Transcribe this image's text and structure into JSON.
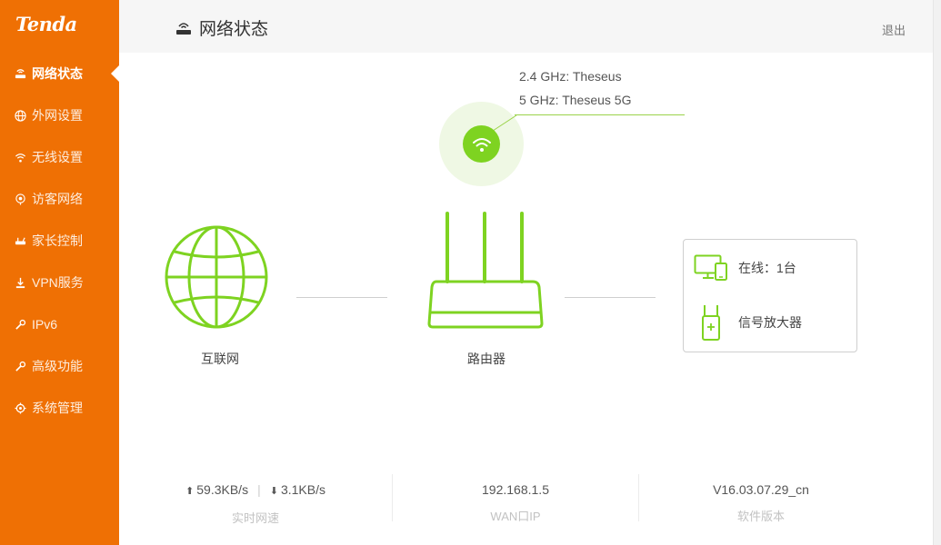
{
  "brand": {
    "logo_text": "Tenda",
    "accent": "#ef7004",
    "green": "#7ed321"
  },
  "sidebar": {
    "items": [
      {
        "label": "网络状态",
        "icon": "router-icon",
        "active": true
      },
      {
        "label": "外网设置",
        "icon": "globe-icon",
        "active": false
      },
      {
        "label": "无线设置",
        "icon": "wifi-icon",
        "active": false
      },
      {
        "label": "访客网络",
        "icon": "guest-icon",
        "active": false
      },
      {
        "label": "家长控制",
        "icon": "parental-icon",
        "active": false
      },
      {
        "label": "VPN服务",
        "icon": "vpn-icon",
        "active": false
      },
      {
        "label": "IPv6",
        "icon": "wrench-icon",
        "active": false
      },
      {
        "label": "高级功能",
        "icon": "wrench-icon",
        "active": false
      },
      {
        "label": "系统管理",
        "icon": "gear-icon",
        "active": false
      }
    ]
  },
  "header": {
    "title": "网络状态",
    "logout": "退出"
  },
  "wifi": {
    "ssid_24": "2.4 GHz: Theseus",
    "ssid_5": "5 GHz: Theseus 5G"
  },
  "topology": {
    "internet_label": "互联网",
    "router_label": "路由器"
  },
  "devices": {
    "online_label": "在线：1台",
    "extender_label": "信号放大器"
  },
  "stats": {
    "upload": "59.3KB/s",
    "download": "3.1KB/s",
    "speed_label": "实时网速",
    "wan_ip": "192.168.1.5",
    "wan_label": "WAN口IP",
    "firmware": "V16.03.07.29_cn",
    "firmware_label": "软件版本"
  }
}
